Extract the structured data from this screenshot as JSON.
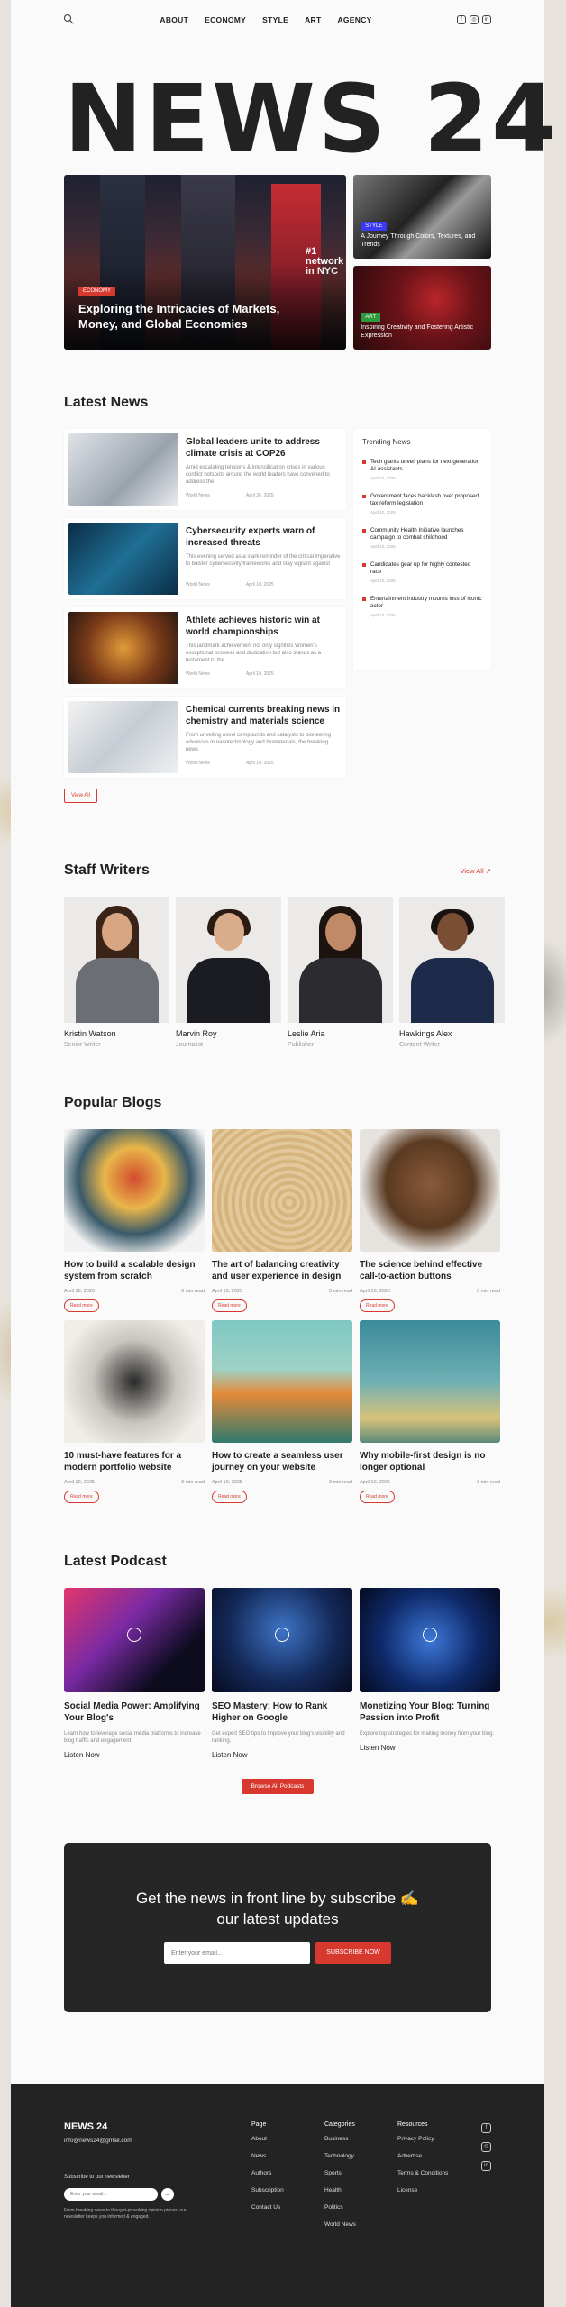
{
  "nav": {
    "items": [
      "ABOUT",
      "ECONOMY",
      "STYLE",
      "ART",
      "AGENCY"
    ],
    "social_icons": [
      "facebook-icon",
      "instagram-icon",
      "linkedin-icon"
    ]
  },
  "logo": "NEWS 24",
  "hero": {
    "main": {
      "tag": "ECONOMY",
      "sign_text": "#1 network in NYC",
      "title": "Exploring the Intricacies of Markets, Money, and Global Economies"
    },
    "side": [
      {
        "tag": "STYLE",
        "title": "A Journey Through Colors, Textures, and Trends"
      },
      {
        "tag": "ART",
        "title": "Inspiring Creativity and Fostering Artistic Expression"
      }
    ]
  },
  "latest": {
    "title": "Latest News",
    "items": [
      {
        "title": "Global leaders unite to address climate crisis at COP26",
        "desc": "Amid escalating tensions & intensification crises in various conflict hotspots around the world leaders have convened to address the",
        "author": "World News",
        "date": "April 26, 2025"
      },
      {
        "title": "Cybersecurity experts warn of increased threats",
        "desc": "This evening served as a stark reminder of the critical imperative to bolster cybersecurity frameworks and stay vigilant against",
        "author": "World News",
        "date": "April 10, 2025"
      },
      {
        "title": "Athlete achieves historic win at world championships",
        "desc": "This landmark achievement not only signifies Women's exceptional prowess and dedication but also stands as a testament to the",
        "author": "World News",
        "date": "April 10, 2025"
      },
      {
        "title": "Chemical currents breaking news in chemistry and materials science",
        "desc": "From unveiling novel compounds and catalysts to pioneering advances in nanotechnology and biomaterials, the breaking news",
        "author": "World News",
        "date": "April 10, 2025"
      }
    ],
    "view_all": "View All"
  },
  "trending": {
    "title": "Trending News",
    "items": [
      {
        "text": "Tech giants unveil plans for next generation AI assistants",
        "date": "April 10, 2025"
      },
      {
        "text": "Government faces backlash over proposed tax reform legislation",
        "date": "April 10, 2025"
      },
      {
        "text": "Community Health Initiative launches campaign to combat childhood",
        "date": "April 10, 2025"
      },
      {
        "text": "Candidates gear up for highly contested race",
        "date": "April 10, 2025"
      },
      {
        "text": "Entertainment industry mourns loss of iconic actor",
        "date": "April 10, 2025"
      }
    ]
  },
  "staff": {
    "title": "Staff Writers",
    "view_all": "View All ↗",
    "members": [
      {
        "name": "Kristin Watson",
        "role": "Senior Writer"
      },
      {
        "name": "Marvin Roy",
        "role": "Journalist"
      },
      {
        "name": "Leslie Aria",
        "role": "Publisher"
      },
      {
        "name": "Hawkings Alex",
        "role": "Content Writer"
      }
    ]
  },
  "blogs": {
    "title": "Popular Blogs",
    "read_label": "Read more",
    "items": [
      {
        "title": "How to build a scalable design system from scratch",
        "date": "April 10, 2025",
        "read": "3 min read"
      },
      {
        "title": "The art of balancing creativity and user experience in design",
        "date": "April 10, 2025",
        "read": "3 min read"
      },
      {
        "title": "The science behind effective call-to-action buttons",
        "date": "April 10, 2025",
        "read": "3 min read"
      },
      {
        "title": "10 must-have features for a modern portfolio website",
        "date": "April 10, 2025",
        "read": "3 min read"
      },
      {
        "title": "How to create a seamless user journey on your website",
        "date": "April 10, 2025",
        "read": "3 min read"
      },
      {
        "title": "Why mobile-first design is no longer optional",
        "date": "April 10, 2025",
        "read": "3 min read"
      }
    ]
  },
  "podcast": {
    "title": "Latest Podcast",
    "items": [
      {
        "title": "Social Media Power: Amplifying Your Blog's",
        "desc": "Learn how to leverage social media platforms to increase blog traffic and engagement.",
        "listen": "Listen Now"
      },
      {
        "title": "SEO Mastery: How to Rank Higher on Google",
        "desc": "Get expert SEO tips to improve your blog's visibility and ranking.",
        "listen": "Listen Now"
      },
      {
        "title": "Monetizing Your Blog: Turning Passion into Profit",
        "desc": "Explore top strategies for making money from your blog.",
        "listen": "Listen Now"
      }
    ],
    "browse": "Browse All Podcasts"
  },
  "subscribe": {
    "title": "Get the news in front line by subscribe ✍ our latest updates",
    "placeholder": "Enter your email...",
    "button": "SUBSCRIBE NOW"
  },
  "footer": {
    "logo": "NEWS 24",
    "email": "info@news24@gmail.com",
    "newsletter_label": "Subscribe to our newsletter",
    "newsletter_placeholder": "Enter your email...",
    "newsletter_note": "From breaking news to thought-provoking opinion pieces, our newsletter keeps you informed & engaged.",
    "columns": [
      {
        "heading": "Page",
        "links": [
          "About",
          "News",
          "Authors",
          "Subscription",
          "Contact Us"
        ]
      },
      {
        "heading": "Categories",
        "links": [
          "Business",
          "Technology",
          "Sports",
          "Health",
          "Politics",
          "World News"
        ]
      },
      {
        "heading": "Resources",
        "links": [
          "Privacy Policy",
          "Advertise",
          "Terms & Conditions",
          "License"
        ]
      }
    ],
    "social_icons": [
      "facebook-icon",
      "instagram-icon",
      "linkedin-icon"
    ]
  }
}
